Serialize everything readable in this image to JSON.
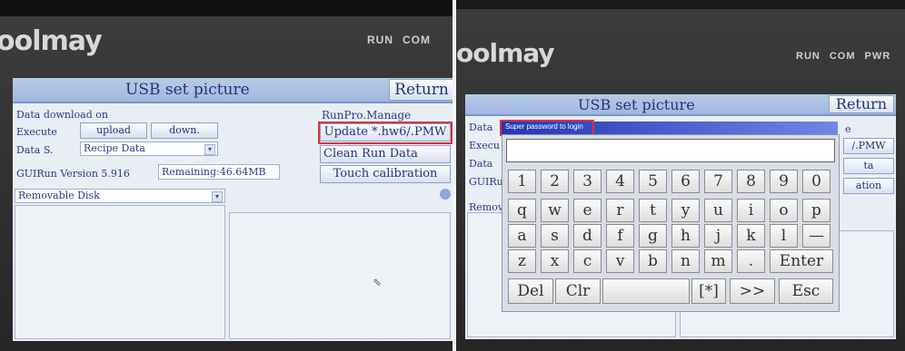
{
  "left": {
    "brand": "oolmay",
    "leds": [
      "RUN",
      "COM"
    ],
    "title": "USB set picture",
    "return_label": "Return",
    "data_download_label": "Data download on",
    "execute_label": "Execute",
    "upload_label": "upload",
    "down_label": "down.",
    "data_s_label": "Data S.",
    "data_s_value": "Recipe Data",
    "version_text": "GUIRun Version 5.916",
    "remaining_text": "Remaining:46.64MB",
    "runpro_label": "RunPro.Manage",
    "update_label": "Update *.hw6/.PMW",
    "clean_label": "Clean Run Data",
    "touch_label": "Touch calibration",
    "removable_disk": "Removable Disk"
  },
  "right": {
    "brand": "oolmay",
    "leds": [
      "RUN",
      "COM",
      "PWR"
    ],
    "title": "USB set picture",
    "return_label": "Return",
    "dialog_title": "Super password to login",
    "bg_labels": [
      "Data",
      "Execu",
      "Data",
      "GUIRu",
      "Remova"
    ],
    "bg_right": [
      "e",
      "/.PMW",
      "ta",
      "ation"
    ],
    "keys_row1": [
      "1",
      "2",
      "3",
      "4",
      "5",
      "6",
      "7",
      "8",
      "9",
      "0"
    ],
    "keys_row2": [
      "q",
      "w",
      "e",
      "r",
      "t",
      "y",
      "u",
      "i",
      "o",
      "p"
    ],
    "keys_row3": [
      "a",
      "s",
      "d",
      "f",
      "g",
      "h",
      "j",
      "k",
      "l",
      "—"
    ],
    "keys_row4": [
      "z",
      "x",
      "c",
      "v",
      "b",
      "n",
      "m",
      ".",
      "Enter"
    ],
    "keys_row5": [
      "Del",
      "Clr",
      "",
      "[*]",
      ">>",
      "Esc"
    ]
  },
  "colors": {
    "screen_bg": "#e9edf4",
    "titlebar": "#a8bfe3",
    "highlight": "#d8333f",
    "text": "#24337c"
  }
}
